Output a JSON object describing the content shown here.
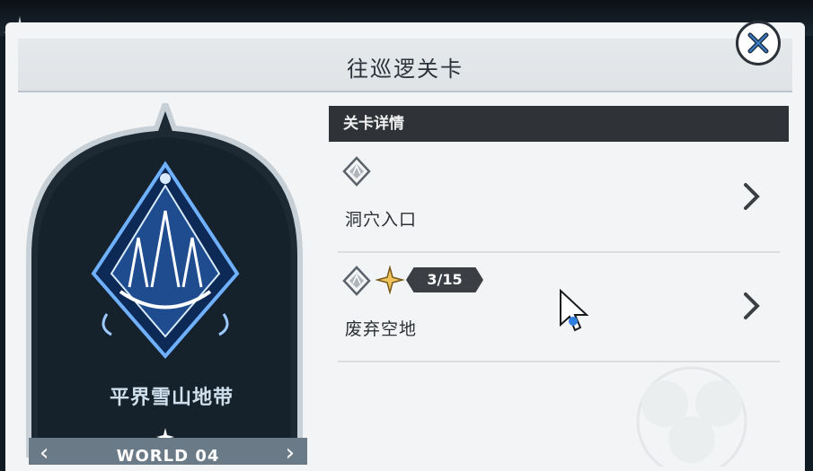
{
  "dialog": {
    "title": "往巡逻关卡"
  },
  "world": {
    "name": "平界雪山地带",
    "code": "WORLD 04"
  },
  "details": {
    "header": "关卡详情",
    "levels": [
      {
        "name": "洞穴入口",
        "icon": "level-crest-icon"
      },
      {
        "name": "废弃空地",
        "icon": "level-crest-icon",
        "star_icon": "gold-star-icon",
        "progress": "3/15"
      }
    ]
  },
  "colors": {
    "panel_bg": "#f3f4f5",
    "header_dark": "#2f3338",
    "world_card": "#1d2a34",
    "emblem_glow": "#3a7bd5"
  }
}
